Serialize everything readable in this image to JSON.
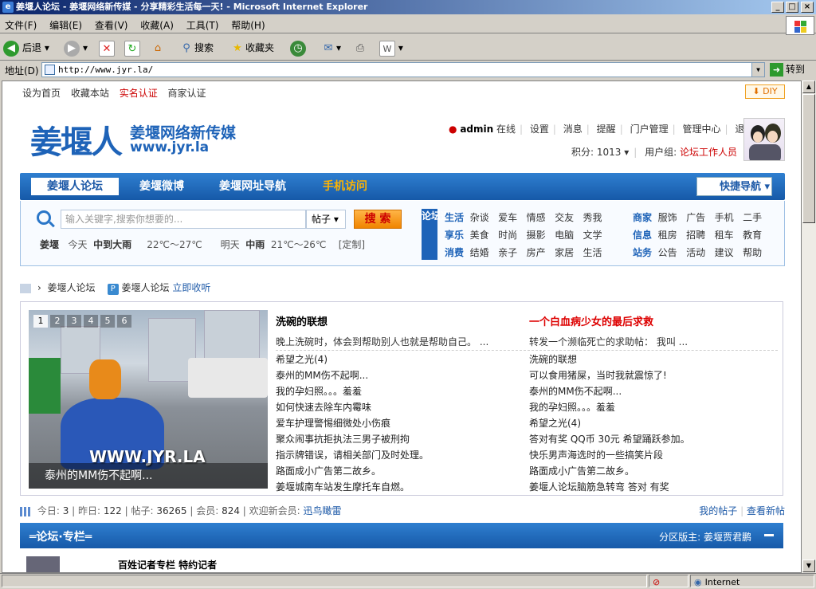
{
  "window": {
    "title": "姜堰人论坛 - 姜堰网络新传媒 - 分享精彩生活每一天! - Microsoft Internet Explorer"
  },
  "menu": [
    "文件(F)",
    "编辑(E)",
    "查看(V)",
    "收藏(A)",
    "工具(T)",
    "帮助(H)"
  ],
  "toolbar": {
    "back": "后退",
    "search": "搜索",
    "favorites": "收藏夹"
  },
  "address": {
    "label": "地址(D)",
    "url": "http://www.jyr.la/",
    "go": "转到"
  },
  "status": {
    "zone": "Internet"
  },
  "page": {
    "top_links": [
      "设为首页",
      "收藏本站",
      "实名认证",
      "商家认证"
    ],
    "diy": "DIY",
    "logo": {
      "main": "姜堰人",
      "sub": "姜堰网络新传媒",
      "url": "www.jyr.la"
    },
    "user": {
      "name": "admin",
      "online": "在线",
      "links": [
        "设置",
        "消息",
        "提醒",
        "门户管理",
        "管理中心",
        "退出"
      ],
      "points_label": "积分:",
      "points": "1013",
      "group_label": "用户组:",
      "group": "论坛工作人员"
    },
    "nav": {
      "items": [
        "姜堰人论坛",
        "姜堰微博",
        "姜堰网址导航",
        "手机访问"
      ],
      "quick": "快捷导航"
    },
    "search": {
      "placeholder": "输入关键字,搜索你想要的...",
      "type": "帖子",
      "button": "搜 索"
    },
    "weather": {
      "city": "姜堰",
      "today": "今天",
      "today_cond": "中到大雨",
      "today_temp": "22℃～27℃",
      "tomorrow": "明天",
      "tomorrow_cond": "中雨",
      "tomorrow_temp": "21℃～26℃",
      "custom": "[定制]"
    },
    "channel_label": "论坛通道",
    "cats1": [
      [
        "生活",
        "杂谈",
        "爱车",
        "情感",
        "交友",
        "秀我"
      ],
      [
        "享乐",
        "美食",
        "时尚",
        "摄影",
        "电脑",
        "文学"
      ],
      [
        "消费",
        "结婚",
        "亲子",
        "房产",
        "家居",
        "生活"
      ]
    ],
    "cats2": [
      [
        "商家",
        "服饰",
        "广告",
        "手机",
        "二手"
      ],
      [
        "信息",
        "租房",
        "招聘",
        "租车",
        "教育"
      ],
      [
        "站务",
        "公告",
        "活动",
        "建议",
        "帮助"
      ]
    ],
    "breadcrumb": {
      "a": "姜堰人论坛",
      "b": "姜堰人论坛",
      "follow": "立即收听"
    },
    "slide": {
      "nums": [
        "1",
        "2",
        "3",
        "4",
        "5",
        "6"
      ],
      "watermark": "WWW.JYR.LA",
      "caption": "泰州的MM伤不起啊..."
    },
    "headline1": {
      "title": "洗碗的联想",
      "desc": "晚上洗碗时，体会到帮助别人也就是帮助自己。 ..."
    },
    "headline2": {
      "title": "一个白血病少女的最后求救",
      "desc": "转发一个濒临死亡的求助帖： 我叫 ..."
    },
    "list1": [
      "希望之光(4)",
      "泰州的MM伤不起啊...",
      "我的孕妇照。。。羞羞",
      "如何快速去除车内霉味",
      "爱车护理警惕细微处小伤痕",
      "聚众闹事抗拒执法三男子被刑拘",
      "指示牌错误，请相关部门及时处理。",
      "路面成小广告第二故乡。",
      "姜堰城南车站发生摩托车自燃。"
    ],
    "list2": [
      "洗碗的联想",
      "可以食用猪屎，当时我就震惊了!",
      "泰州的MM伤不起啊...",
      "我的孕妇照。。。羞羞",
      "希望之光(4)",
      "答对有奖 QQ币 30元 希望踊跃参加。",
      "快乐男声海选时的一些搞笑片段",
      "路面成小广告第二故乡。",
      "姜堰人论坛脑筋急转弯 答对 有奖"
    ],
    "stats": {
      "today_label": "今日:",
      "today": "3",
      "yesterday_label": "昨日:",
      "yesterday": "122",
      "posts_label": "帖子:",
      "posts": "36265",
      "members_label": "会员:",
      "members": "824",
      "welcome": "欢迎新会员:",
      "new_member": "迅鸟瞰雷",
      "my_posts": "我的帖子",
      "new_posts": "查看新帖"
    },
    "column": {
      "title": "═论坛·专栏═",
      "moderator_label": "分区版主:",
      "moderator": "姜堰贾君鹏"
    },
    "column_row": "百姓记者专栏 特约记者"
  }
}
